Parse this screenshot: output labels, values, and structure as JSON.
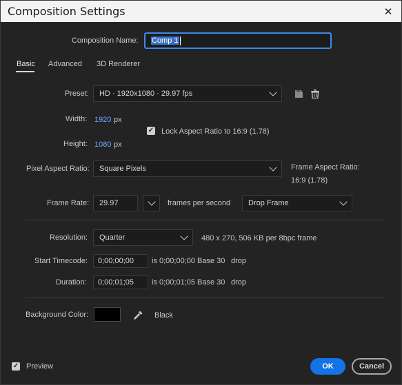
{
  "window": {
    "title": "Composition Settings",
    "close_glyph": "✕"
  },
  "comp_name": {
    "label": "Composition Name:",
    "value": "Comp 1"
  },
  "tabs": [
    {
      "label": "Basic",
      "active": true
    },
    {
      "label": "Advanced",
      "active": false
    },
    {
      "label": "3D Renderer",
      "active": false
    }
  ],
  "preset": {
    "label": "Preset:",
    "value": "HD · 1920x1080 · 29.97 fps"
  },
  "width": {
    "label": "Width:",
    "value": "1920",
    "unit": "px"
  },
  "height": {
    "label": "Height:",
    "value": "1080",
    "unit": "px"
  },
  "lock_aspect": {
    "label": "Lock Aspect Ratio to 16:9 (1.78)",
    "checked": true
  },
  "pixel_aspect": {
    "label": "Pixel Aspect Ratio:",
    "value": "Square Pixels"
  },
  "frame_aspect": {
    "label": "Frame Aspect Ratio:",
    "value": "16:9 (1.78)"
  },
  "frame_rate": {
    "label": "Frame Rate:",
    "value": "29.97",
    "suffix": "frames per second",
    "drop_mode": "Drop Frame"
  },
  "resolution": {
    "label": "Resolution:",
    "value": "Quarter",
    "info": "480 x 270, 506 KB per 8bpc frame"
  },
  "start_timecode": {
    "label": "Start Timecode:",
    "value": "0;00;00;00",
    "is_text": "is 0;00;00;00",
    "base": "Base 30",
    "drop": "drop"
  },
  "duration": {
    "label": "Duration:",
    "value": "0;00;01;05",
    "is_text": "is 0;00;01;05",
    "base": "Base 30",
    "drop": "drop"
  },
  "background": {
    "label": "Background Color:",
    "color_name": "Black",
    "color": "#000000"
  },
  "footer": {
    "preview_label": "Preview",
    "preview_checked": true,
    "ok_label": "OK",
    "cancel_label": "Cancel"
  },
  "colors": {
    "accent": "#1473e6",
    "link_value": "#6aa8ff",
    "background": "#232323"
  }
}
